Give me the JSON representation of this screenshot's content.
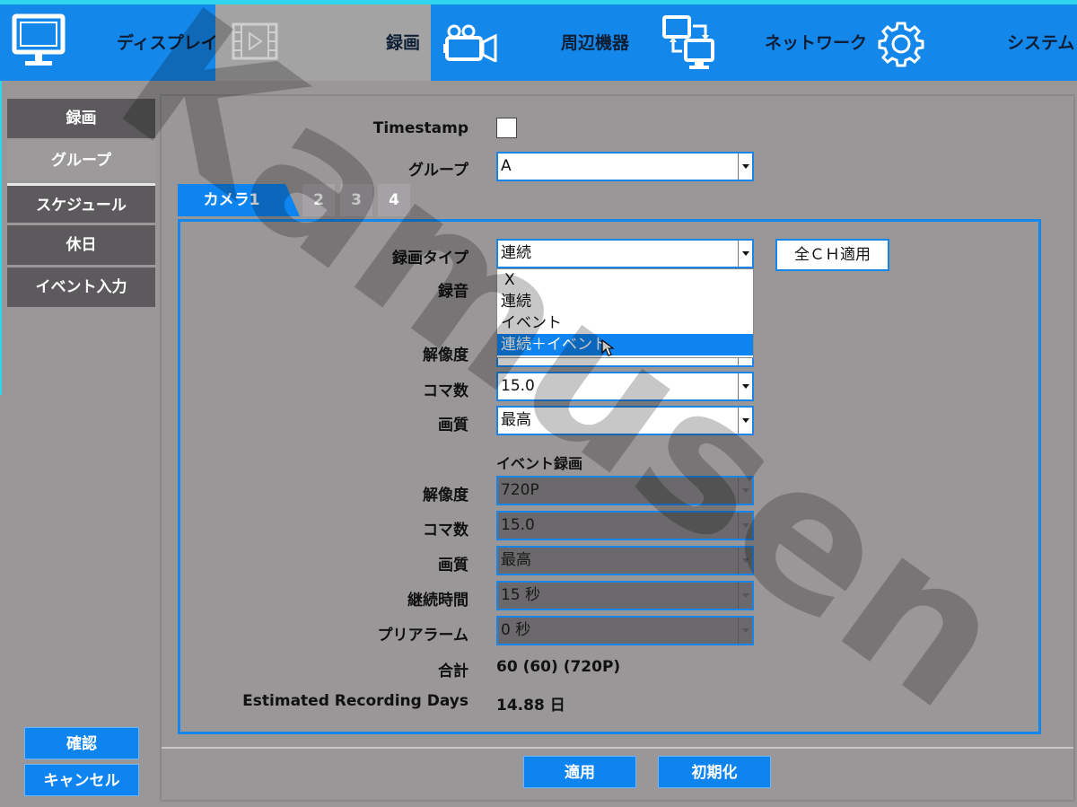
{
  "topnav": {
    "items": [
      {
        "label": "ディスプレイ",
        "icon": "monitor-icon"
      },
      {
        "label": "録画",
        "icon": "film-icon"
      },
      {
        "label": "周辺機器",
        "icon": "camera-icon"
      },
      {
        "label": "ネットワーク",
        "icon": "network-icon"
      },
      {
        "label": "システム",
        "icon": "gear-icon"
      }
    ]
  },
  "sidebar": {
    "items": [
      {
        "label": "録画"
      },
      {
        "label": "グループ"
      },
      {
        "label": "スケジュール"
      },
      {
        "label": "休日"
      },
      {
        "label": "イベント入力"
      }
    ],
    "confirm": "確認",
    "cancel": "キャンセル"
  },
  "form": {
    "timestamp_label": "Timestamp",
    "group_label": "グループ",
    "group_value": "A"
  },
  "camera_tabs": [
    "カメラ1",
    "2",
    "3",
    "4"
  ],
  "camera": {
    "rec_type_label": "録画タイプ",
    "rec_type_value": "連続",
    "apply_all": "全ＣＨ適用",
    "audio_label": "録音",
    "dropdown_options": [
      "X",
      "連続",
      "イベント",
      "連続＋イベント"
    ],
    "resolution_label": "解像度",
    "fps_label": "コマ数",
    "fps_value": "15.0",
    "quality_label": "画質",
    "quality_value": "最高",
    "event_section_title": "イベント録画",
    "ev_resolution_label": "解像度",
    "ev_resolution_value": "720P",
    "ev_fps_label": "コマ数",
    "ev_fps_value": "15.0",
    "ev_quality_label": "画質",
    "ev_quality_value": "最高",
    "duration_label": "継続時間",
    "duration_value": "15 秒",
    "prealarm_label": "プリアラーム",
    "prealarm_value": "0 秒",
    "total_label": "合計",
    "total_value": "60 (60) (720P)",
    "est_days_label": "Estimated Recording Days",
    "est_days_value": "14.88 日"
  },
  "footer": {
    "apply": "適用",
    "reset": "初期化"
  },
  "watermark": "Kamusen",
  "colors": {
    "accent": "#1487ea",
    "top_border": "#2fd4ef",
    "panel_bg": "#9a9799",
    "sidebar_btn": "#5c5a5c"
  }
}
